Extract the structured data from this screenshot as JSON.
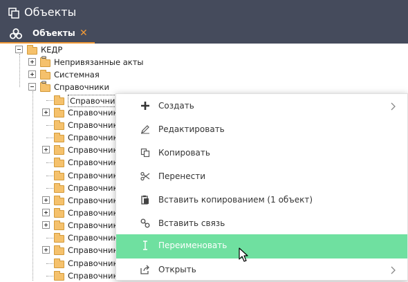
{
  "window": {
    "title": "Объекты"
  },
  "tab": {
    "label": "Объекты",
    "close": "✕"
  },
  "tree": {
    "root": "КЕДР",
    "items": [
      "Непривязанные акты",
      "Системная",
      "Справочники"
    ],
    "children": [
      "Справочник",
      "Справочник",
      "Справочник",
      "Справочник",
      "Справочник",
      "Справочник",
      "Справочник",
      "Справочник",
      "Справочник",
      "Справочник",
      "Справочник",
      "Справочник",
      "Справочник",
      "Справочник",
      "Справочник"
    ]
  },
  "context_menu": {
    "items": [
      {
        "label": "Создать",
        "icon": "plus-icon",
        "submenu": true
      },
      {
        "label": "Редактировать",
        "icon": "edit-icon"
      },
      {
        "label": "Копировать",
        "icon": "copy-icon"
      },
      {
        "label": "Перенести",
        "icon": "scissors-icon"
      },
      {
        "label": "Вставить копированием (1 объект)",
        "icon": "paste-icon"
      },
      {
        "label": "Вставить связь",
        "icon": "link-icon"
      },
      {
        "label": "Переименовать",
        "icon": "text-cursor-icon",
        "highlighted": true
      },
      {
        "label": "Открыть",
        "icon": "open-icon",
        "submenu": true
      }
    ]
  },
  "colors": {
    "titlebar": "#454b5c",
    "tab_accent": "#f29a37",
    "highlight": "#6fe0a0",
    "folder": "#f5c16c"
  }
}
